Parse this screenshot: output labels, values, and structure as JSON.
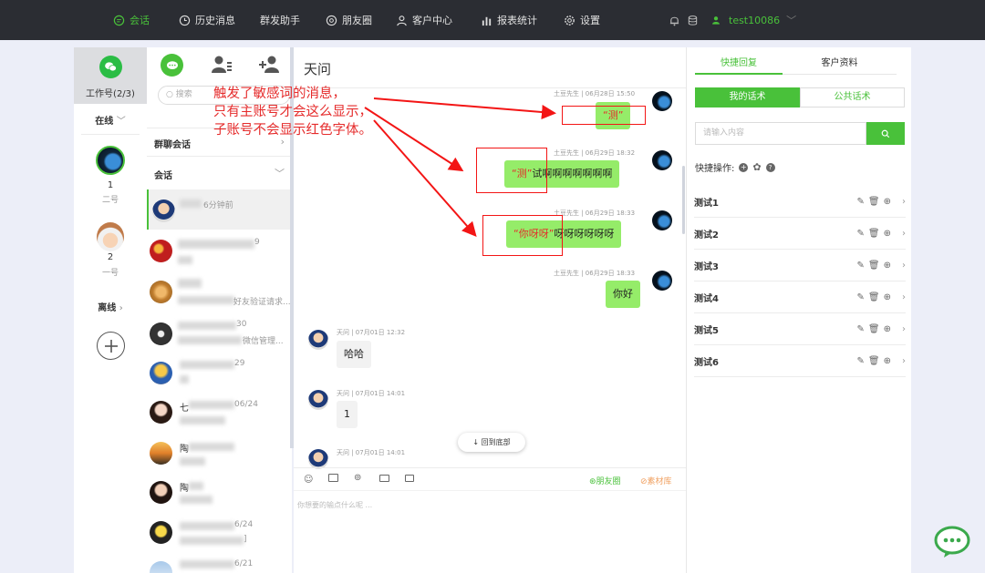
{
  "topbar": {
    "nav": [
      {
        "label": "会话",
        "icon": "chat-bubble-icon"
      },
      {
        "label": "历史消息",
        "icon": "clock-icon"
      },
      {
        "label": "群发助手",
        "icon": ""
      },
      {
        "label": "朋友圈",
        "icon": "camera-aperture-icon"
      },
      {
        "label": "客户中心",
        "icon": "person-icon"
      },
      {
        "label": "报表统计",
        "icon": "bar-chart-icon"
      },
      {
        "label": "设置",
        "icon": "gear-icon"
      }
    ],
    "username": "test10086"
  },
  "sidebar": {
    "work_label": "工作号(2/3)",
    "online_label": "在线",
    "accounts": [
      {
        "num": "1",
        "sub": "二号"
      },
      {
        "num": "2",
        "sub": "一号"
      }
    ],
    "offline_label": "离线"
  },
  "col2": {
    "search_placeholder": "搜索",
    "group_header": "群聊会话",
    "session_header": "会话",
    "first_item_time": "6分钟前",
    "items": [
      {
        "text": ""
      },
      {
        "text": "9"
      },
      {
        "text": "好友验证请求..."
      },
      {
        "text": "30"
      },
      {
        "text": "微信管理..."
      },
      {
        "text": "29"
      },
      {
        "text": "七"
      },
      {
        "text": "06/24"
      },
      {
        "text": "陶"
      },
      {
        "text": "陶"
      },
      {
        "text": "6/24"
      },
      {
        "text": "]"
      },
      {
        "text": "6/21"
      }
    ]
  },
  "chat": {
    "title": "天问",
    "messages": [
      {
        "meta": "土豆先生 | 06月28日 15:50",
        "text": "“测”"
      },
      {
        "meta": "土豆先生 | 06月29日 18:32",
        "hl": "“测”",
        "rest": "试啊啊啊啊啊啊啊"
      },
      {
        "meta": "土豆先生 | 06月29日 18:33",
        "hl": "“你呀呀”",
        "rest": "呀呀呀呀呀呀"
      },
      {
        "meta": "土豆先生 | 06月29日 18:33",
        "text": "你好"
      },
      {
        "meta": "天问 | 07月01日 12:32",
        "text": "哈哈"
      },
      {
        "meta": "天问 | 07月01日 14:01",
        "text": "1"
      },
      {
        "meta": "天问 | 07月01日 14:01",
        "text": ""
      }
    ],
    "back_to_bottom": "回到底部",
    "toolbar": {
      "moments": "朋友圈",
      "materials": "素材库"
    },
    "input_placeholder": "你想要的输点什么呢 ..."
  },
  "annotation": {
    "line1": "触发了敏感词的消息，",
    "line2": "只有主账号才会这么显示，",
    "line3": "子账号不会显示红色字体。"
  },
  "right": {
    "tabs": [
      "快捷回复",
      "客户资料"
    ],
    "subtabs": [
      "我的话术",
      "公共话术"
    ],
    "input_placeholder": "请输入内容",
    "quick_ops_label": "快捷操作:",
    "items": [
      "测试1",
      "测试2",
      "测试3",
      "测试4",
      "测试5",
      "测试6"
    ]
  },
  "colors": {
    "accent": "#49c13a",
    "bubble": "#95ec69",
    "annotation": "#e52b2b",
    "topbar": "#2b2d33"
  }
}
